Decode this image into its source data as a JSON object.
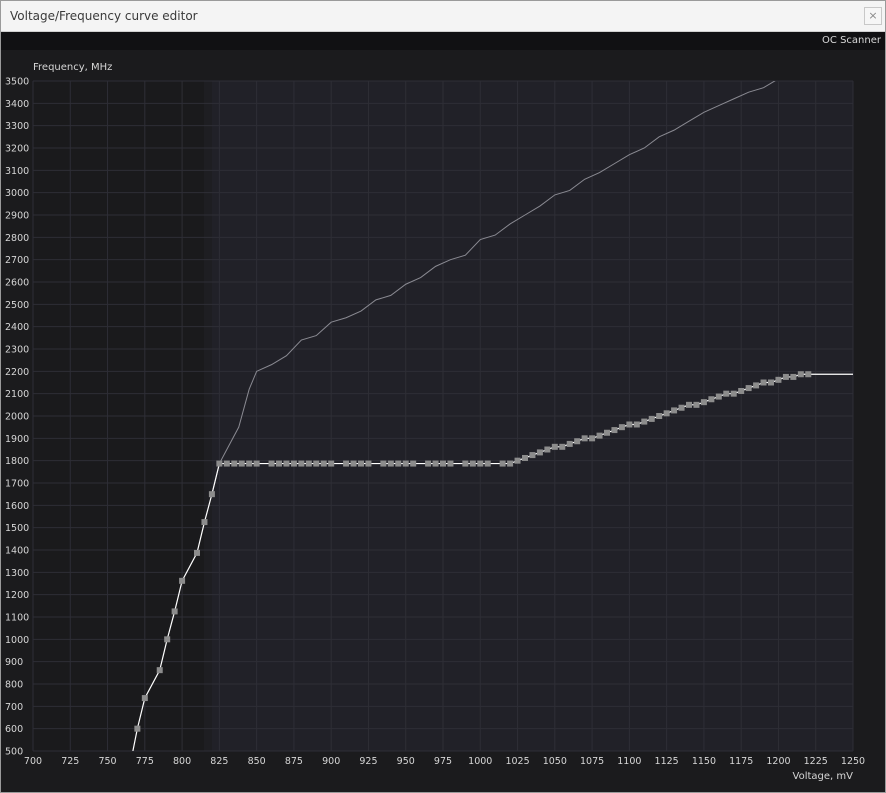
{
  "window": {
    "title": "Voltage/Frequency curve editor",
    "close_label": "×",
    "oc_scanner_label": "OC Scanner"
  },
  "colors": {
    "background": "#1b1b1d",
    "plot_background": "#212128",
    "locked_region": "#1a1a1c",
    "grid": "#2e2e36",
    "curve": "#ffffff",
    "ceiling_curve": "#8a8a92",
    "point": "#8c8c8c"
  },
  "chart_data": {
    "type": "line",
    "title": "",
    "xlabel": "Voltage, mV",
    "ylabel": "Frequency, MHz",
    "xlim": [
      700,
      1250
    ],
    "ylim": [
      500,
      3500
    ],
    "xticks": [
      700,
      725,
      750,
      775,
      800,
      825,
      850,
      875,
      900,
      925,
      950,
      975,
      1000,
      1025,
      1050,
      1075,
      1100,
      1125,
      1150,
      1175,
      1200,
      1225,
      1250
    ],
    "yticks": [
      500,
      600,
      700,
      800,
      900,
      1000,
      1100,
      1200,
      1300,
      1400,
      1500,
      1600,
      1700,
      1800,
      1900,
      2000,
      2100,
      2200,
      2300,
      2400,
      2500,
      2600,
      2700,
      2800,
      2900,
      3000,
      3100,
      3200,
      3300,
      3400,
      3500
    ],
    "grid": true,
    "locked_voltage_max": 820,
    "series": [
      {
        "values_kind": "curve",
        "points": [
          [
            767,
            500
          ],
          [
            770,
            600
          ],
          [
            775,
            737
          ],
          [
            785,
            862
          ],
          [
            790,
            1000
          ],
          [
            795,
            1125
          ],
          [
            800,
            1262
          ],
          [
            810,
            1387
          ],
          [
            815,
            1525
          ],
          [
            820,
            1650
          ],
          [
            825,
            1787
          ],
          [
            830,
            1787
          ],
          [
            835,
            1787
          ],
          [
            840,
            1787
          ],
          [
            845,
            1787
          ],
          [
            850,
            1787
          ],
          [
            860,
            1787
          ],
          [
            865,
            1787
          ],
          [
            870,
            1787
          ],
          [
            875,
            1787
          ],
          [
            880,
            1787
          ],
          [
            885,
            1787
          ],
          [
            890,
            1787
          ],
          [
            895,
            1787
          ],
          [
            900,
            1787
          ],
          [
            910,
            1787
          ],
          [
            915,
            1787
          ],
          [
            920,
            1787
          ],
          [
            925,
            1787
          ],
          [
            935,
            1787
          ],
          [
            940,
            1787
          ],
          [
            945,
            1787
          ],
          [
            950,
            1787
          ],
          [
            955,
            1787
          ],
          [
            965,
            1787
          ],
          [
            970,
            1787
          ],
          [
            975,
            1787
          ],
          [
            980,
            1787
          ],
          [
            990,
            1787
          ],
          [
            995,
            1787
          ],
          [
            1000,
            1787
          ],
          [
            1005,
            1787
          ],
          [
            1015,
            1787
          ],
          [
            1020,
            1787
          ],
          [
            1025,
            1800
          ],
          [
            1030,
            1812
          ],
          [
            1035,
            1825
          ],
          [
            1040,
            1837
          ],
          [
            1045,
            1850
          ],
          [
            1050,
            1862
          ],
          [
            1055,
            1862
          ],
          [
            1060,
            1875
          ],
          [
            1065,
            1887
          ],
          [
            1070,
            1900
          ],
          [
            1075,
            1900
          ],
          [
            1080,
            1912
          ],
          [
            1085,
            1925
          ],
          [
            1090,
            1937
          ],
          [
            1095,
            1950
          ],
          [
            1100,
            1962
          ],
          [
            1105,
            1962
          ],
          [
            1110,
            1975
          ],
          [
            1115,
            1987
          ],
          [
            1120,
            2000
          ],
          [
            1125,
            2012
          ],
          [
            1130,
            2025
          ],
          [
            1135,
            2037
          ],
          [
            1140,
            2050
          ],
          [
            1145,
            2050
          ],
          [
            1150,
            2062
          ],
          [
            1155,
            2075
          ],
          [
            1160,
            2087
          ],
          [
            1165,
            2100
          ],
          [
            1170,
            2100
          ],
          [
            1175,
            2112
          ],
          [
            1180,
            2125
          ],
          [
            1185,
            2137
          ],
          [
            1190,
            2150
          ],
          [
            1195,
            2150
          ],
          [
            1200,
            2162
          ],
          [
            1205,
            2175
          ],
          [
            1210,
            2175
          ],
          [
            1215,
            2187
          ],
          [
            1220,
            2187
          ],
          [
            1250,
            2187
          ]
        ],
        "markers_xmax": 1222
      },
      {
        "values_kind": "ceiling",
        "points": [
          [
            820,
            1650
          ],
          [
            825,
            1787
          ],
          [
            830,
            1850
          ],
          [
            838,
            1950
          ],
          [
            845,
            2120
          ],
          [
            850,
            2200
          ],
          [
            860,
            2230
          ],
          [
            870,
            2270
          ],
          [
            880,
            2340
          ],
          [
            890,
            2360
          ],
          [
            900,
            2420
          ],
          [
            910,
            2440
          ],
          [
            920,
            2470
          ],
          [
            930,
            2520
          ],
          [
            940,
            2540
          ],
          [
            950,
            2590
          ],
          [
            960,
            2620
          ],
          [
            970,
            2670
          ],
          [
            980,
            2700
          ],
          [
            990,
            2720
          ],
          [
            1000,
            2790
          ],
          [
            1010,
            2810
          ],
          [
            1020,
            2860
          ],
          [
            1030,
            2900
          ],
          [
            1040,
            2940
          ],
          [
            1050,
            2990
          ],
          [
            1060,
            3010
          ],
          [
            1070,
            3060
          ],
          [
            1080,
            3090
          ],
          [
            1090,
            3130
          ],
          [
            1100,
            3170
          ],
          [
            1110,
            3200
          ],
          [
            1120,
            3250
          ],
          [
            1130,
            3280
          ],
          [
            1140,
            3320
          ],
          [
            1150,
            3360
          ],
          [
            1160,
            3390
          ],
          [
            1170,
            3420
          ],
          [
            1180,
            3450
          ],
          [
            1190,
            3470
          ],
          [
            1200,
            3510
          ]
        ]
      }
    ]
  }
}
